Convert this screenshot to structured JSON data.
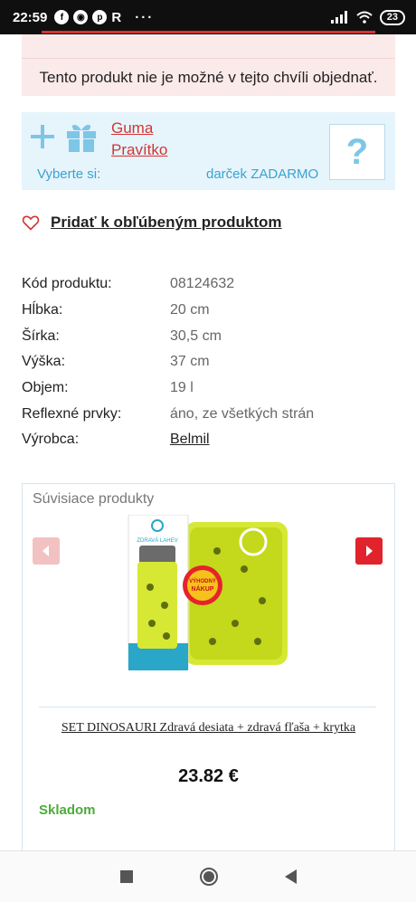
{
  "status_bar": {
    "time": "22:59",
    "app_letter": "R",
    "more": "···",
    "battery": "23"
  },
  "alert": {
    "message": "Tento produkt nie je možné v tejto chvíli objednať."
  },
  "gift": {
    "links": [
      "Guma",
      "Pravítko"
    ],
    "choose_label": "Vyberte si:",
    "free_label": "darček ZADARMO",
    "placeholder": "?"
  },
  "favorite": {
    "label": "Pridať k obľúbeným produktom"
  },
  "specs": [
    {
      "key": "Kód produktu:",
      "value": "08124632"
    },
    {
      "key": "Hĺbka:",
      "value": "20 cm"
    },
    {
      "key": "Šírka:",
      "value": "30,5 cm"
    },
    {
      "key": "Výška:",
      "value": "37 cm"
    },
    {
      "key": "Objem:",
      "value": "19 l"
    },
    {
      "key": "Reflexné prvky:",
      "value": "áno, ze všetkých strán"
    },
    {
      "key": "Výrobca:",
      "value": "Belmil"
    }
  ],
  "related": {
    "title": "Súvisiace produkty",
    "product_name": "SET DINOSAURI Zdravá desiata + zdravá fľaša + krytka",
    "price": "23.82 €",
    "stock": "Skladom",
    "image_text": {
      "bottle": "ZDRAVÁ LAHEV",
      "badge_top": "VÝHODNÝ",
      "badge_bottom": "NÁKUP"
    }
  },
  "colors": {
    "accent_red": "#d23535",
    "info_blue": "#7dc6e6",
    "stock_green": "#4cab3a"
  }
}
